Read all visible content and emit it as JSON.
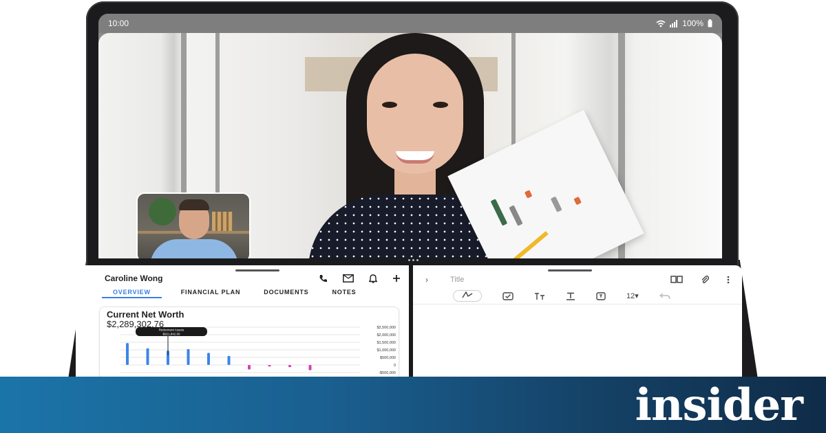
{
  "statusbar": {
    "time": "10:00",
    "battery": "100%"
  },
  "icons": {
    "wifi": "wifi-icon",
    "signal": "signal-icon",
    "battery": "battery-icon"
  },
  "crm": {
    "client_name": "Caroline Wong",
    "tabs": [
      {
        "label": "OVERVIEW",
        "active": true
      },
      {
        "label": "FINANCIAL PLAN",
        "active": false
      },
      {
        "label": "DOCUMENTS",
        "active": false
      },
      {
        "label": "NOTES",
        "active": false
      }
    ],
    "card_title": "Current Net Worth",
    "card_value": "$2,289,302.76"
  },
  "chart_data": {
    "type": "bar",
    "title": "",
    "yticks": [
      "$2,500,000",
      "$2,000,000",
      "$1,500,000",
      "$1,000,000",
      "$500,000",
      "0",
      "-$500,000"
    ],
    "ylim": [
      -500000,
      2500000
    ],
    "series": [
      {
        "color": "#3b86e8",
        "values": [
          1450000,
          1100000,
          950000,
          1050000,
          800000,
          600000,
          0,
          0,
          0,
          0
        ]
      },
      {
        "color": "#d63fb4",
        "values": [
          0,
          0,
          0,
          0,
          0,
          0,
          -300000,
          -100000,
          -150000,
          -350000
        ]
      }
    ],
    "tooltip": {
      "label": "Retirement Assets",
      "value": "$921,842.00",
      "index": 2
    }
  },
  "notes": {
    "title_placeholder": "Title",
    "font_size": "12"
  },
  "brand": {
    "name": "insider"
  },
  "colors": {
    "accent": "#3b7de0",
    "banner_start": "#1b74a8",
    "banner_end": "#0f2c48"
  }
}
